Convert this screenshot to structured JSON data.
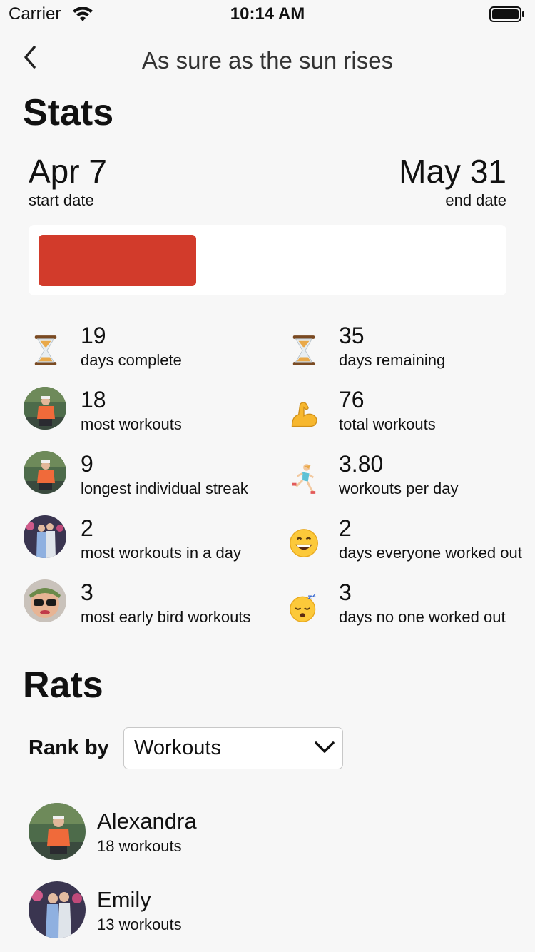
{
  "status": {
    "carrier": "Carrier",
    "time": "10:14 AM"
  },
  "nav": {
    "title": "As sure as the sun rises"
  },
  "stats": {
    "heading": "Stats",
    "start_date": "Apr 7",
    "start_label": "start date",
    "end_date": "May 31",
    "end_label": "end date",
    "progress_fraction": 0.345,
    "progress_color": "#d23b2b",
    "items": [
      {
        "icon": "hourglass-icon",
        "value": "19",
        "label": "days complete"
      },
      {
        "icon": "hourglass-icon",
        "value": "35",
        "label": "days remaining"
      },
      {
        "icon": "avatar-alexandra",
        "value": "18",
        "label": "most workouts"
      },
      {
        "icon": "flexed-biceps-icon",
        "value": "76",
        "label": "total workouts"
      },
      {
        "icon": "avatar-alexandra",
        "value": "9",
        "label": "longest individual streak"
      },
      {
        "icon": "running-person-icon",
        "value": "3.80",
        "label": "workouts per day"
      },
      {
        "icon": "avatar-emily",
        "value": "2",
        "label": "most workouts in a day"
      },
      {
        "icon": "grinning-face-icon",
        "value": "2",
        "label": "days everyone worked out"
      },
      {
        "icon": "avatar-early-bird",
        "value": "3",
        "label": "most early bird workouts"
      },
      {
        "icon": "sleeping-face-icon",
        "value": "3",
        "label": "days no one worked out"
      }
    ]
  },
  "rats": {
    "heading": "Rats",
    "rank_by_label": "Rank by",
    "rank_by_value": "Workouts",
    "rows": [
      {
        "name": "Alexandra",
        "detail": "18 workouts"
      },
      {
        "name": "Emily",
        "detail": "13 workouts"
      }
    ]
  }
}
